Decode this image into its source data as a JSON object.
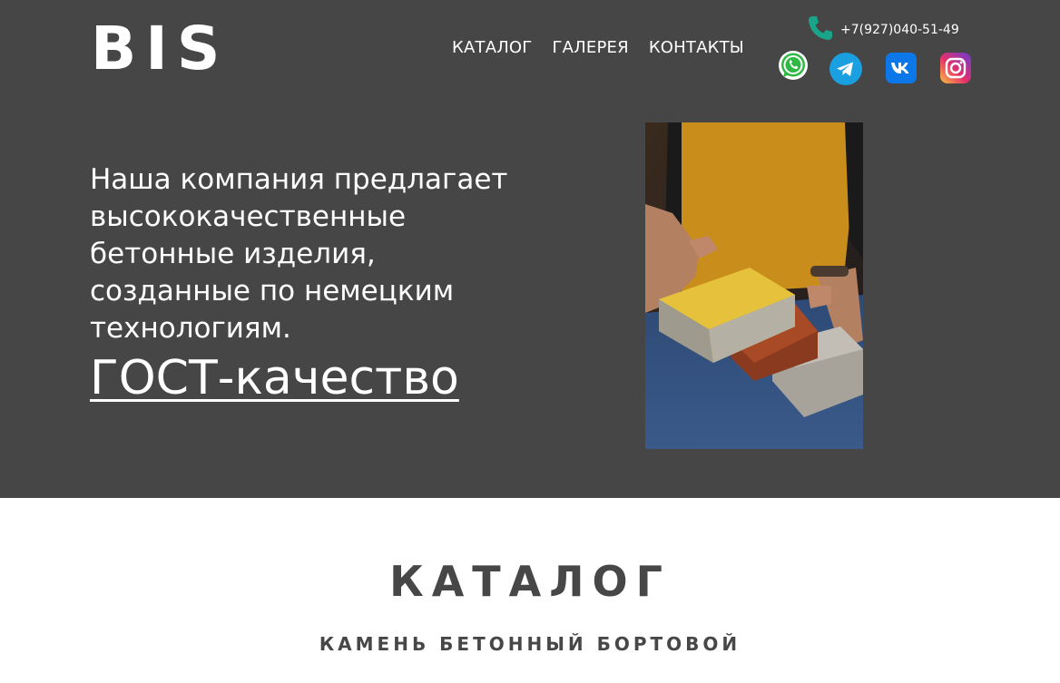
{
  "header": {
    "logo": "BIS",
    "nav": [
      {
        "label": "КАТАЛОГ"
      },
      {
        "label": "ГАЛЕРЕЯ"
      },
      {
        "label": "КОНТАКТЫ"
      }
    ],
    "phone": "+7(927)040-51-49",
    "socials": [
      "whatsapp-icon",
      "telegram-icon",
      "vk-icon",
      "instagram-icon"
    ]
  },
  "hero": {
    "tagline": "Наша компания предлагает высококачественные бетонные изделия, созданные по немецким технологиям.",
    "gost_link": "ГОСТ-качество"
  },
  "catalog": {
    "title": "КАТАЛОГ",
    "subtitle": "КАМЕНЬ БЕТОННЫЙ БОРТОВОЙ"
  },
  "colors": {
    "hero_bg": "#464646",
    "text_dark": "#474747",
    "phone_icon": "#1aa58a"
  }
}
